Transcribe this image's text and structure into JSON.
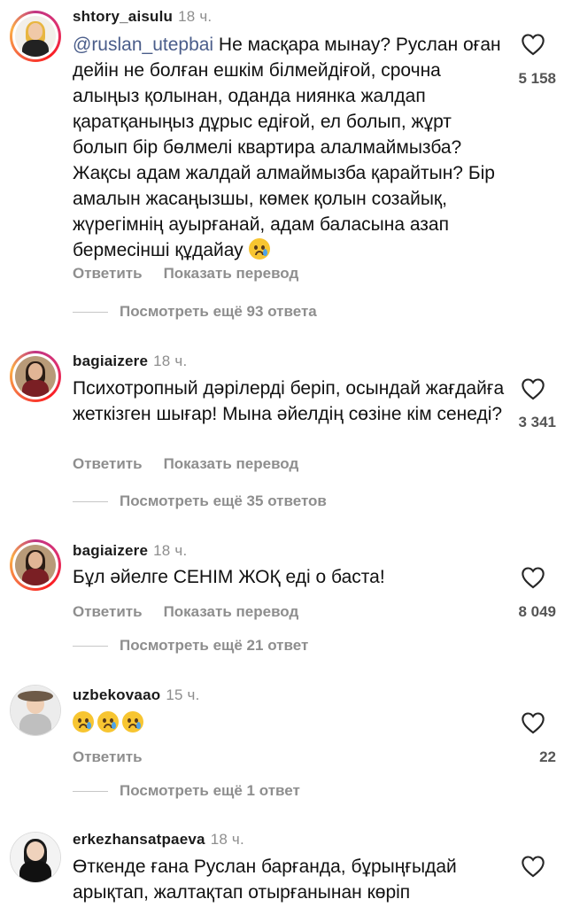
{
  "comments": [
    {
      "username": "shtory_aisulu",
      "time": "18 ч.",
      "mention": "@ruslan_utepbai",
      "text": " Не масқара мынау?  Руслан оған дейін не болған ешкім білмейдіғой, срочна алыңыз қолынан, оданда ниянка жалдап қаратқаныңыз дұрыс едіғой, ел болып, жұрт болып бір бөлмелі квартира алалмаймызба? Жақсы адам жалдай алмаймызба қарайтын? Бір амалын жасаңызшы, көмек қолын созайық, жүрегімнің ауырғанай, адам баласына азап бермесінші құдайау",
      "reply_label": "Ответить",
      "translate_label": "Показать перевод",
      "likes": "5 158",
      "view_replies": "Посмотреть ещё 93 ответа"
    },
    {
      "username": "bagiaizere",
      "time": "18 ч.",
      "text": "Психотропный дәрілерді беріп, осындай жағдайға жеткізген шығар! Мына әйелдің сөзіне кім сенеді?",
      "reply_label": "Ответить",
      "translate_label": "Показать перевод",
      "likes": "3 341",
      "view_replies": "Посмотреть ещё 35 ответов"
    },
    {
      "username": "bagiaizere",
      "time": "18 ч.",
      "text": "Бұл әйелге СЕНІМ ЖОҚ еді о баста!",
      "reply_label": "Ответить",
      "translate_label": "Показать перевод",
      "likes": "8 049",
      "view_replies": "Посмотреть ещё 21 ответ"
    },
    {
      "username": "uzbekovaao",
      "time": "15 ч.",
      "reply_label": "Ответить",
      "likes": "22",
      "view_replies": "Посмотреть ещё 1 ответ"
    },
    {
      "username": "erkezhansatpaeva",
      "time": "18 ч.",
      "text": "Өткенде ғана Руслан барғанда, бұрыңғыдай арықтап, жалтақтап отырғанынан көріп"
    }
  ]
}
